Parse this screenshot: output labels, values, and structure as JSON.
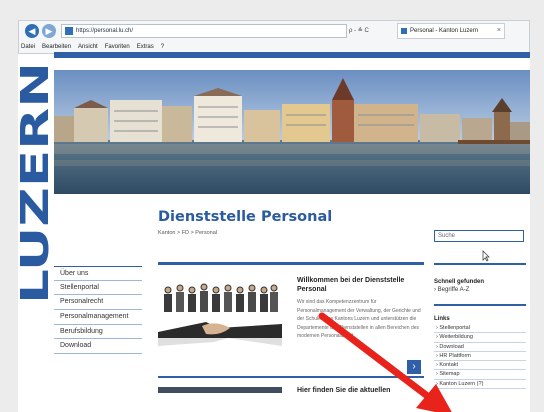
{
  "browser": {
    "url": "https://personal.lu.ch/",
    "tab_title": "Personal - Kanton Luzern",
    "address_tools": "ρ - ≙ C",
    "menu": [
      "Datei",
      "Bearbeiten",
      "Ansicht",
      "Favoriten",
      "Extras",
      "?"
    ]
  },
  "site": {
    "logo": "LUZERN",
    "title": "Dienststelle Personal",
    "breadcrumb": "Kanton > FD > Personal",
    "search_placeholder": "Suche"
  },
  "left_nav": [
    "Über uns",
    "Stellenportal",
    "Personalrecht",
    "Personalmanagement",
    "Berufsbildung",
    "Download"
  ],
  "welcome": {
    "title": "Willkommen bei der Dienststelle Personal",
    "text": "Wir sind das Kompetenzzentrum für Personalmanagement der Verwaltung, der Gerichte und der Schulen des Kantons Luzern und unterstützen die Departemente und Dienststellen in allen Bereichen des modernen Personalarbeit.",
    "more_arrow": "›"
  },
  "lower_teaser_title": "Hier finden Sie die aktuellen",
  "quick": {
    "title": "Schnell gefunden",
    "link": "Begriffe A-Z"
  },
  "links": {
    "title": "Links",
    "items": [
      "Stellenportal",
      "Weiterbildung",
      "Download",
      "HR Plattform",
      "Kontakt",
      "Sitemap",
      "Kanton Luzern (?)"
    ]
  },
  "colors": {
    "brand_blue": "#2f5fa6",
    "arrow_red": "#e8231c"
  }
}
